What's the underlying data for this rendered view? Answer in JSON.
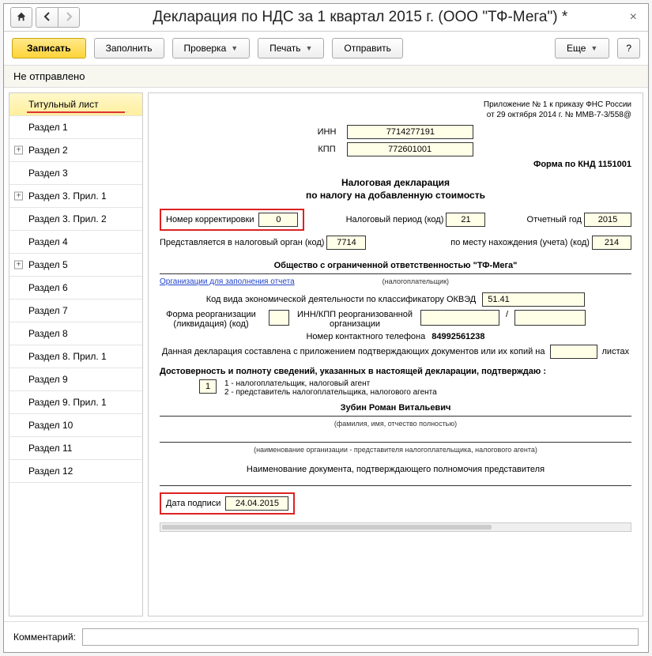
{
  "header": {
    "title": "Декларация по НДС за 1 квартал 2015 г. (ООО \"ТФ-Мега\") *"
  },
  "toolbar": {
    "save": "Записать",
    "fill": "Заполнить",
    "check": "Проверка",
    "print": "Печать",
    "send": "Отправить",
    "more": "Еще",
    "help": "?"
  },
  "status": "Не отправлено",
  "sidebar": {
    "items": [
      {
        "label": "Титульный лист",
        "active": true
      },
      {
        "label": "Раздел 1"
      },
      {
        "label": "Раздел 2",
        "expandable": true
      },
      {
        "label": "Раздел 3"
      },
      {
        "label": "Раздел 3. Прил. 1",
        "expandable": true
      },
      {
        "label": "Раздел 3. Прил. 2"
      },
      {
        "label": "Раздел 4"
      },
      {
        "label": "Раздел 5",
        "expandable": true
      },
      {
        "label": "Раздел 6"
      },
      {
        "label": "Раздел 7"
      },
      {
        "label": "Раздел 8"
      },
      {
        "label": "Раздел 8. Прил. 1"
      },
      {
        "label": "Раздел 9"
      },
      {
        "label": "Раздел 9. Прил. 1"
      },
      {
        "label": "Раздел 10"
      },
      {
        "label": "Раздел 11"
      },
      {
        "label": "Раздел 12"
      }
    ]
  },
  "form": {
    "app_note1": "Приложение № 1 к приказу ФНС России",
    "app_note2": "от 29 октября 2014 г. № ММВ-7-3/558@",
    "inn_label": "ИНН",
    "inn": "7714277191",
    "kpp_label": "КПП",
    "kpp": "772601001",
    "knd": "Форма по КНД 1151001",
    "title": "Налоговая декларация",
    "subtitle": "по налогу на добавленную стоимость",
    "corr_label": "Номер корректировки",
    "corr": "0",
    "period_label": "Налоговый период (код)",
    "period": "21",
    "year_label": "Отчетный год",
    "year": "2015",
    "organ_label": "Представляется в налоговый орган (код)",
    "organ": "7714",
    "place_label": "по месту нахождения (учета) (код)",
    "place": "214",
    "org_name": "Общество с ограниченной ответственностью \"ТФ-Мега\"",
    "org_link": "Организации для заполнения отчета",
    "org_note": "(налогоплательщик)",
    "okved_label": "Код вида экономической деятельности по классификатору ОКВЭД",
    "okved": "51.41",
    "reorg_label": "Форма реорганизации (ликвидация) (код)",
    "reorg_inn_label": "ИНН/КПП реорганизованной организации",
    "phone_label": "Номер контактного телефона",
    "phone": "84992561238",
    "attach_label_pre": "Данная декларация составлена с приложением подтверждающих документов или их копий на",
    "attach_label_post": "листах",
    "confirm_heading": "Достоверность и полноту сведений, указанных в настоящей декларации, подтверждаю :",
    "confirm_opt1": "1 - налогоплательщик, налоговый агент",
    "confirm_opt2": "2 - представитель налогоплательщика, налогового агента",
    "confirm_val": "1",
    "signer": "Зубин Роман Витальевич",
    "signer_note": "(фамилия, имя, отчество полностью)",
    "rep_note": "(наименование организации - представителя налогоплательщика, налогового агента)",
    "doc_label": "Наименование документа, подтверждающего полномочия представителя",
    "sign_date_label": "Дата подписи",
    "sign_date": "24.04.2015"
  },
  "footer": {
    "comment_label": "Комментарий:"
  }
}
